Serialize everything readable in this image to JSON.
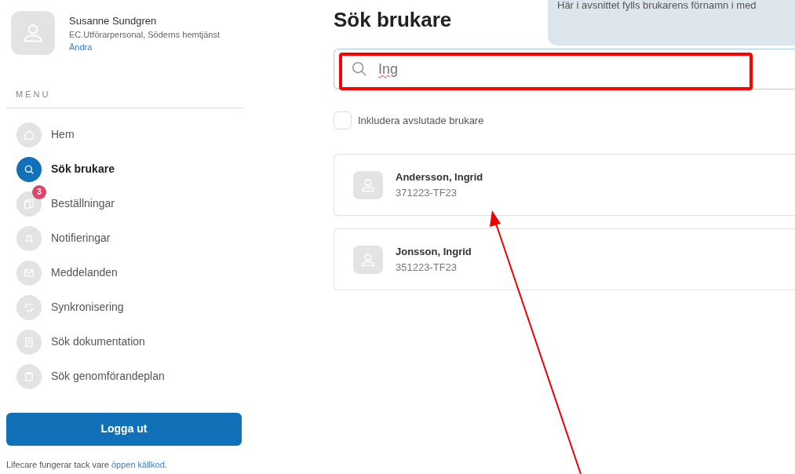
{
  "user": {
    "name": "Susanne Sundgren",
    "role": "EC.Utförarpersonal, Söderns hemtjänst",
    "change_link": "Ändra"
  },
  "menu": {
    "title": "MENU",
    "items": [
      {
        "label": "Hem",
        "kind": "home",
        "selected": false
      },
      {
        "label": "Sök brukare",
        "kind": "search",
        "selected": true
      },
      {
        "label": "Beställningar",
        "kind": "orders",
        "selected": false,
        "badge": "3"
      },
      {
        "label": "Notifieringar",
        "kind": "bell",
        "selected": false
      },
      {
        "label": "Meddelanden",
        "kind": "mail",
        "selected": false
      },
      {
        "label": "Synkronisering",
        "kind": "sync",
        "selected": false
      },
      {
        "label": "Sök dokumentation",
        "kind": "doc",
        "selected": false
      },
      {
        "label": "Sök genomförandeplan",
        "kind": "clipboard",
        "selected": false
      }
    ]
  },
  "logout_button": "Logga ut",
  "footer": {
    "text": "Lifecare fungerar tack vare ",
    "link": "öppen källkod",
    "end": "."
  },
  "page_title": "Sök brukare",
  "tooltip": "Här i avsnittet fylls brukarens förnamn i med",
  "search": {
    "value": "Ing"
  },
  "include_closed": {
    "label": "Inkludera avslutade brukare",
    "checked": false
  },
  "results": [
    {
      "name": "Andersson, Ingrid",
      "id": "371223-TF23"
    },
    {
      "name": "Jonsson, Ingrid",
      "id": "351223-TF23"
    }
  ],
  "annotations": {
    "highlight_search": true,
    "arrow_to_result": true
  }
}
